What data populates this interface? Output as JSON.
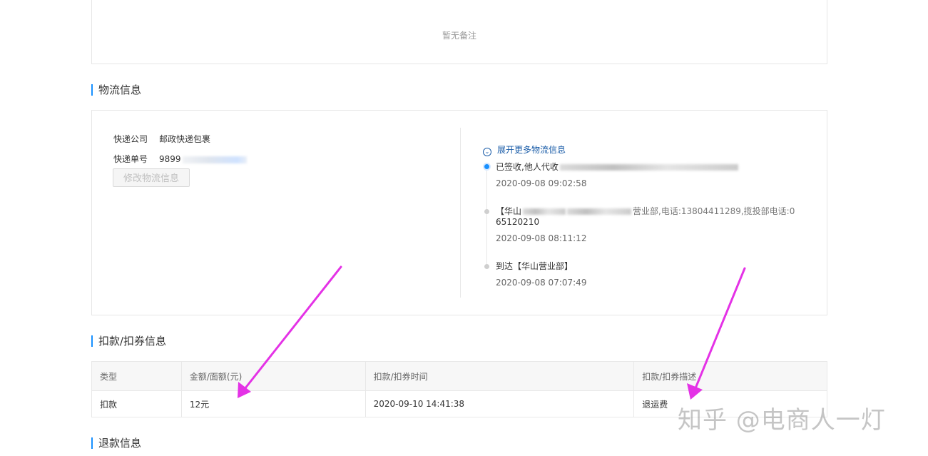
{
  "remarks": {
    "empty_text": "暂无备注"
  },
  "logistics": {
    "section_title": "物流信息",
    "company_label": "快递公司",
    "company_value": "邮政快递包裹",
    "tracking_label": "快递单号",
    "tracking_value_prefix": "9899",
    "modify_button": "修改物流信息",
    "expand_link": "展开更多物流信息",
    "events": [
      {
        "text": "已签收,他人代收",
        "time": "2020-09-08 09:02:58",
        "active": true
      },
      {
        "text": "【华山",
        "text_tail": "营业部,电话:13804411289,揽投部电话:0",
        "text_line2": "65120210",
        "time": "2020-09-08 08:11:12",
        "active": false
      },
      {
        "text": "到达【华山营业部】",
        "time": "2020-09-08 07:07:49",
        "active": false
      }
    ]
  },
  "deduction": {
    "section_title": "扣款/扣券信息",
    "columns": [
      "类型",
      "金额/面额(元)",
      "扣款/扣券时间",
      "扣款/扣券描述"
    ],
    "rows": [
      [
        "扣款",
        "12元",
        "2020-09-10 14:41:38",
        "退运费"
      ]
    ]
  },
  "refund": {
    "section_title": "退款信息"
  },
  "watermark": "知乎 @电商人一灯",
  "colors": {
    "accent": "#1890ff",
    "arrow": "#e432e6",
    "link": "#1a5ca8"
  }
}
